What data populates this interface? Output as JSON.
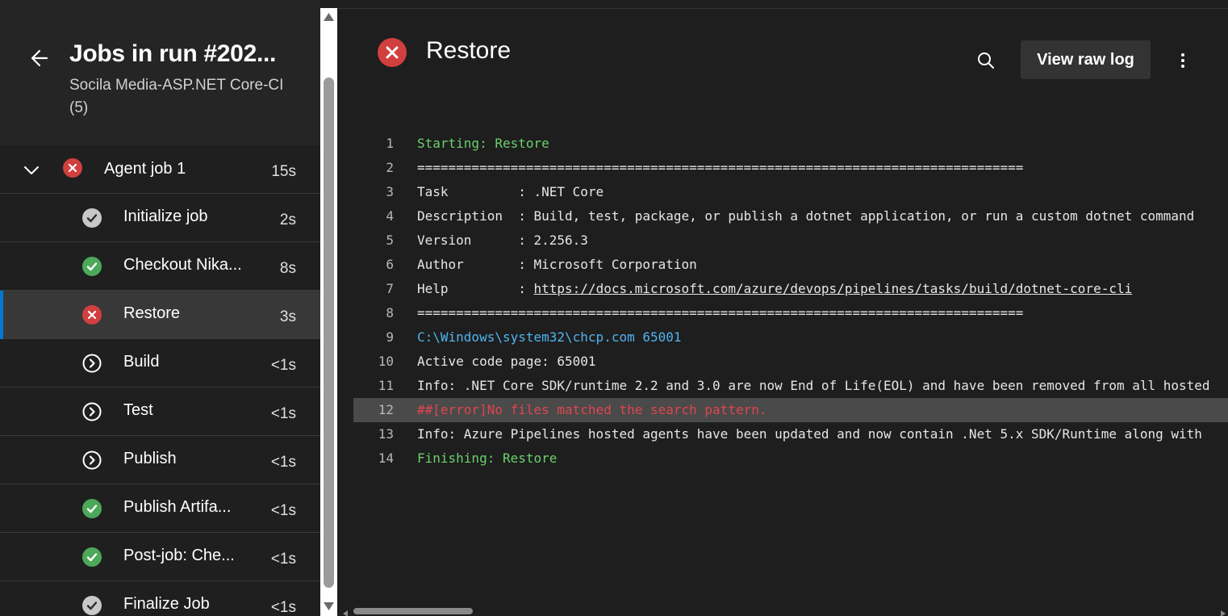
{
  "left": {
    "title": "Jobs in run #202...",
    "subtitle": "Socila Media-ASP.NET Core-CI (5)",
    "agent_job": {
      "label": "Agent job 1",
      "duration": "15s",
      "status": "failed"
    },
    "steps": [
      {
        "label": "Initialize job",
        "duration": "2s",
        "status": "succeeded-gray",
        "icon": "check-circle-icon"
      },
      {
        "label": "Checkout Nika...",
        "duration": "8s",
        "status": "succeeded",
        "icon": "check-circle-icon"
      },
      {
        "label": "Restore",
        "duration": "3s",
        "status": "failed",
        "icon": "error-circle-icon",
        "selected": true
      },
      {
        "label": "Build",
        "duration": "<1s",
        "status": "skipped",
        "icon": "skip-circle-icon"
      },
      {
        "label": "Test",
        "duration": "<1s",
        "status": "skipped",
        "icon": "skip-circle-icon"
      },
      {
        "label": "Publish",
        "duration": "<1s",
        "status": "skipped",
        "icon": "skip-circle-icon"
      },
      {
        "label": "Publish Artifa...",
        "duration": "<1s",
        "status": "succeeded",
        "icon": "check-circle-icon"
      },
      {
        "label": "Post-job: Che...",
        "duration": "<1s",
        "status": "succeeded",
        "icon": "check-circle-icon"
      },
      {
        "label": "Finalize Job",
        "duration": "<1s",
        "status": "succeeded-gray",
        "icon": "check-circle-icon"
      }
    ]
  },
  "right": {
    "title": "Restore",
    "raw_log_label": "View raw log",
    "log": [
      {
        "n": "1",
        "text": "Starting: Restore",
        "style": "green"
      },
      {
        "n": "2",
        "text": "==============================================================================",
        "style": ""
      },
      {
        "n": "3",
        "text": "Task         : .NET Core",
        "style": ""
      },
      {
        "n": "4",
        "text": "Description  : Build, test, package, or publish a dotnet application, or run a custom dotnet command",
        "style": ""
      },
      {
        "n": "5",
        "text": "Version      : 2.256.3",
        "style": ""
      },
      {
        "n": "6",
        "text": "Author       : Microsoft Corporation",
        "style": ""
      },
      {
        "n": "7",
        "text": "Help         : ",
        "link": "https://docs.microsoft.com/azure/devops/pipelines/tasks/build/dotnet-core-cli",
        "style": ""
      },
      {
        "n": "8",
        "text": "==============================================================================",
        "style": ""
      },
      {
        "n": "9",
        "text": "C:\\Windows\\system32\\chcp.com 65001",
        "style": "blue"
      },
      {
        "n": "10",
        "text": "Active code page: 65001",
        "style": ""
      },
      {
        "n": "11",
        "text": "Info: .NET Core SDK/runtime 2.2 and 3.0 are now End of Life(EOL) and have been removed from all hosted",
        "style": ""
      },
      {
        "n": "12",
        "text": "##[error]No files matched the search pattern.",
        "style": "red",
        "highlight": true
      },
      {
        "n": "13",
        "text": "Info: Azure Pipelines hosted agents have been updated and now contain .Net 5.x SDK/Runtime along with",
        "style": ""
      },
      {
        "n": "14",
        "text": "Finishing: Restore",
        "style": "green"
      }
    ]
  },
  "colors": {
    "success": "#4ca85a",
    "error": "#d13f3f",
    "neutral": "#c8c8c8",
    "accent": "#0078d4",
    "log_green": "#6ad16d",
    "log_blue": "#4fb4f0",
    "log_red": "#e0454f"
  }
}
